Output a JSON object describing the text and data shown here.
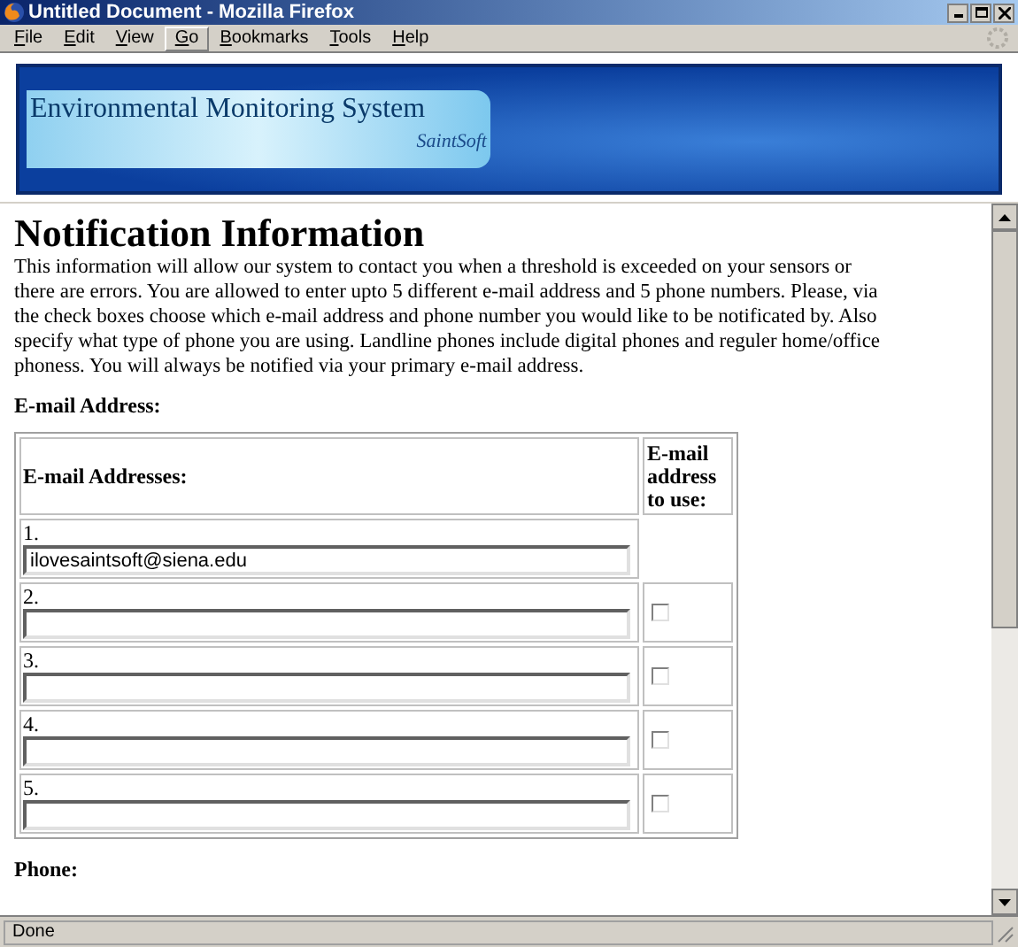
{
  "window": {
    "title": "Untitled Document - Mozilla Firefox"
  },
  "menu": [
    {
      "label": "File",
      "hovered": false
    },
    {
      "label": "Edit",
      "hovered": false
    },
    {
      "label": "View",
      "hovered": false
    },
    {
      "label": "Go",
      "hovered": true
    },
    {
      "label": "Bookmarks",
      "hovered": false
    },
    {
      "label": "Tools",
      "hovered": false
    },
    {
      "label": "Help",
      "hovered": false
    }
  ],
  "banner": {
    "title": "Environmental Monitoring System",
    "subtitle": "SaintSoft"
  },
  "heading": "Notification Information",
  "intro": "This information will allow our system to contact you when a threshold is exceeded on your sensors or there are errors. You are allowed to enter upto 5 different e-mail address and 5 phone numbers. Please, via the check boxes choose which e-mail address and phone number you would like to be notificated by. Also specify what type of phone you are using. Landline phones include digital phones and reguler home/office phoness. You will always be notified via your primary e-mail address.",
  "email_section": "E-mail Address:",
  "email_table": {
    "columns": [
      "E-mail Addresses:",
      "E-mail address to use:"
    ],
    "rows": [
      {
        "number": "1.",
        "value": "ilovesaintsoft@siena.edu"
      },
      {
        "number": "2.",
        "checked": false
      },
      {
        "number": "3.",
        "checked": false
      },
      {
        "number": "4.",
        "checked": false
      },
      {
        "number": "5.",
        "checked": false
      }
    ]
  },
  "phone_section": "Phone:",
  "status_bar": "Done"
}
